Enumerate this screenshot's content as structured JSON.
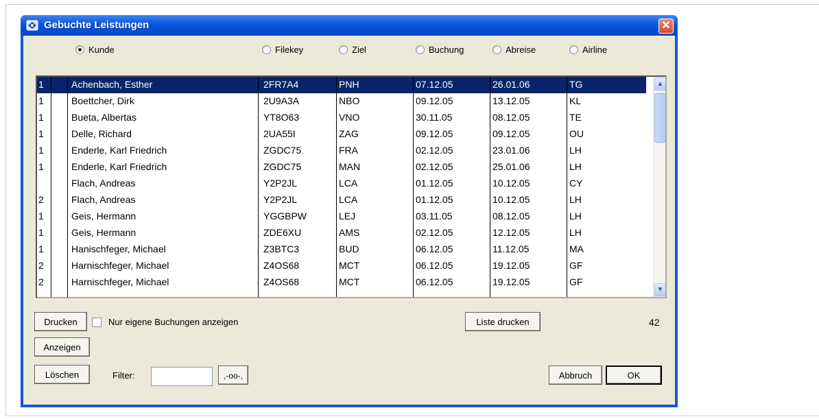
{
  "window": {
    "title": "Gebuchte Leistungen",
    "close_symbol": "✕"
  },
  "sort_options": [
    {
      "label": "Kunde",
      "checked": true
    },
    {
      "label": "Filekey",
      "checked": false
    },
    {
      "label": "Ziel",
      "checked": false
    },
    {
      "label": "Buchung",
      "checked": false
    },
    {
      "label": "Abreise",
      "checked": false
    },
    {
      "label": "Airline",
      "checked": false
    }
  ],
  "list": {
    "rows": [
      {
        "count": "1",
        "name": "Achenbach, Esther",
        "filekey": "2FR7A4",
        "ziel": "PNH",
        "buchung": "07.12.05",
        "abreise": "26.01.06",
        "airline": "TG",
        "selected": true
      },
      {
        "count": "1",
        "name": "Boettcher, Dirk",
        "filekey": "2U9A3A",
        "ziel": "NBO",
        "buchung": "09.12.05",
        "abreise": "13.12.05",
        "airline": "KL"
      },
      {
        "count": "1",
        "name": "Bueta, Albertas",
        "filekey": "YT8O63",
        "ziel": "VNO",
        "buchung": "30.11.05",
        "abreise": "08.12.05",
        "airline": "TE"
      },
      {
        "count": "1",
        "name": "Delle, Richard",
        "filekey": "2UA55I",
        "ziel": "ZAG",
        "buchung": "09.12.05",
        "abreise": "09.12.05",
        "airline": "OU"
      },
      {
        "count": "1",
        "name": "Enderle, Karl Friedrich",
        "filekey": "ZGDC75",
        "ziel": "FRA",
        "buchung": "02.12.05",
        "abreise": "23.01.06",
        "airline": "LH"
      },
      {
        "count": "1",
        "name": "Enderle, Karl Friedrich",
        "filekey": "ZGDC75",
        "ziel": "MAN",
        "buchung": "02.12.05",
        "abreise": "25.01.06",
        "airline": "LH"
      },
      {
        "count": "",
        "name": "Flach, Andreas",
        "filekey": "Y2P2JL",
        "ziel": "LCA",
        "buchung": "01.12.05",
        "abreise": "10.12.05",
        "airline": "CY"
      },
      {
        "count": "2",
        "name": "Flach, Andreas",
        "filekey": "Y2P2JL",
        "ziel": "LCA",
        "buchung": "01.12.05",
        "abreise": "10.12.05",
        "airline": "LH"
      },
      {
        "count": "1",
        "name": "Geis, Hermann",
        "filekey": "YGGBPW",
        "ziel": "LEJ",
        "buchung": "03.11.05",
        "abreise": "08.12.05",
        "airline": "LH"
      },
      {
        "count": "1",
        "name": "Geis, Hermann",
        "filekey": "ZDE6XU",
        "ziel": "AMS",
        "buchung": "02.12.05",
        "abreise": "12.12.05",
        "airline": "LH"
      },
      {
        "count": "1",
        "name": "Hanischfeger, Michael",
        "filekey": "Z3BTC3",
        "ziel": "BUD",
        "buchung": "06.12.05",
        "abreise": "11.12.05",
        "airline": "MA"
      },
      {
        "count": "2",
        "name": "Harnischfeger, Michael",
        "filekey": "Z4OS68",
        "ziel": "MCT",
        "buchung": "06.12.05",
        "abreise": "19.12.05",
        "airline": "GF"
      },
      {
        "count": "2",
        "name": "Harnischfeger, Michael",
        "filekey": "Z4OS68",
        "ziel": "MCT",
        "buchung": "06.12.05",
        "abreise": "19.12.05",
        "airline": "GF"
      }
    ],
    "scroll_up_symbol": "▲",
    "scroll_down_symbol": "▼"
  },
  "controls": {
    "drucken": "Drucken",
    "nur_eigene": "Nur eigene Buchungen anzeigen",
    "liste_drucken": "Liste drucken",
    "total_count": "42",
    "anzeigen": "Anzeigen",
    "loeschen": "Löschen",
    "filter_label": "Filter:",
    "filter_value": "",
    "filter_btn": ",-oo-,",
    "abbruch": "Abbruch",
    "ok": "OK"
  }
}
